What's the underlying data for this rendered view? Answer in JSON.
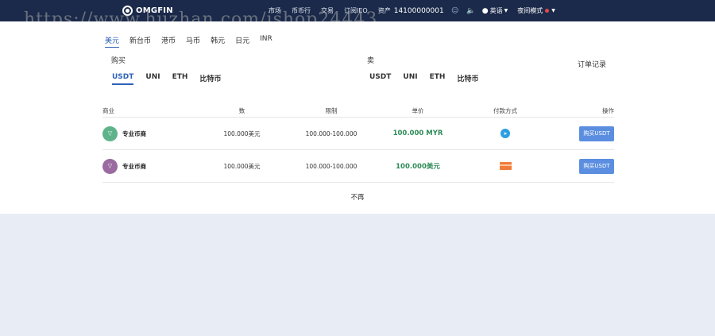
{
  "header": {
    "logo_text": "OMGFIN",
    "nav": [
      "市场",
      "币币行",
      "交易",
      "订阅IEO",
      "资产"
    ],
    "balance": "14100000001",
    "language": "英语",
    "night_mode": "夜间模式"
  },
  "watermark": "https://www.huzhan.com/ishop24443",
  "currency_tabs": [
    "美元",
    "新台币",
    "港币",
    "马币",
    "韩元",
    "日元",
    "INR"
  ],
  "buy_label": "购买",
  "sell_label": "卖",
  "orders_link": "订单记录",
  "buy_coins": [
    "USDT",
    "UNI",
    "ETH",
    "比特币"
  ],
  "sell_coins": [
    "USDT",
    "UNI",
    "ETH",
    "比特币"
  ],
  "table": {
    "headers": [
      "商业",
      "数",
      "限制",
      "单价",
      "付款方式",
      "操作"
    ],
    "rows": [
      {
        "merchant": "专业币商",
        "amount": "100.000美元",
        "limit": "100.000-100.000",
        "price": "100.000 MYR",
        "payment": "telegram-icon",
        "action": "购买USDT",
        "avatar_color": "#5fb38a"
      },
      {
        "merchant": "专业币商",
        "amount": "100.000美元",
        "limit": "100.000-100.000",
        "price": "100.000美元",
        "payment": "bank-card-icon",
        "action": "购买USDT",
        "avatar_color": "#9a6aa0"
      }
    ]
  },
  "footer_text": "不再",
  "colors": {
    "header_bg": "#1b2a4a",
    "accent": "#2f62b8",
    "price": "#2e8b57",
    "button": "#5b8ee0",
    "page_bg": "#e8edf5"
  }
}
